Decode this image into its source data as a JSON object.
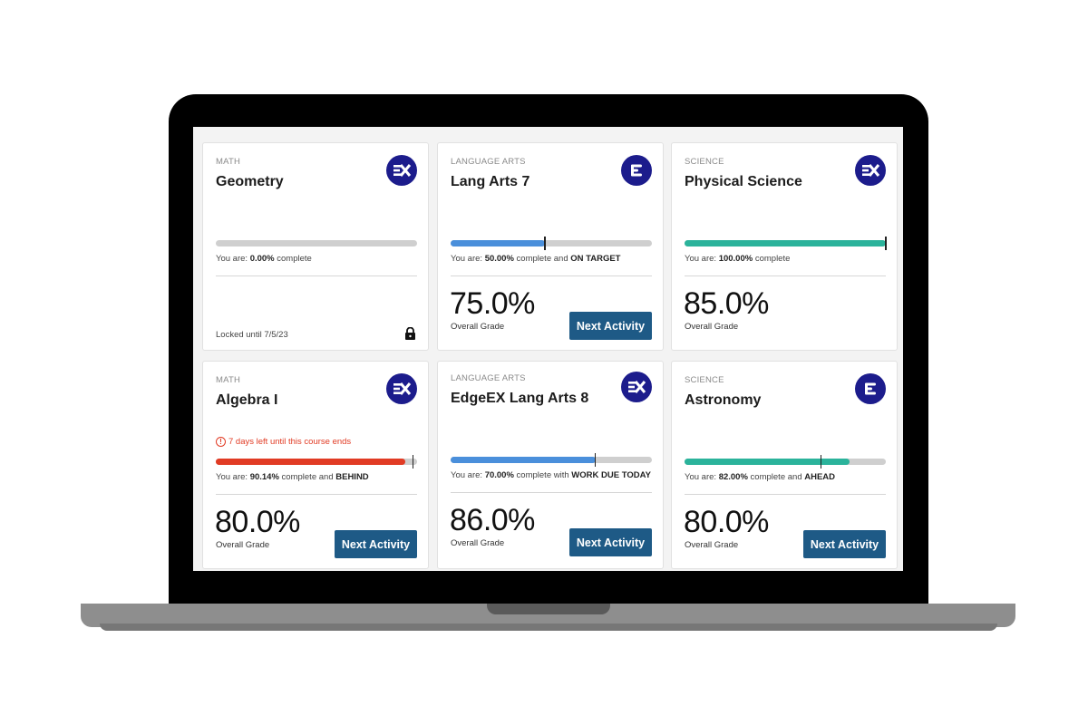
{
  "next_activity_label": "Next Activity",
  "overall_grade_label": "Overall Grade",
  "courses": [
    {
      "subject": "MATH",
      "title": "Geometry",
      "logo": "ex-icon",
      "status_prefix": "You are: ",
      "percent": "0.00%",
      "status_mid": " complete",
      "status_tag": "",
      "progress": 0.0,
      "progress_color": "#cfcfcf",
      "target": null,
      "locked_text": "Locked until 7/5/23"
    },
    {
      "subject": "LANGUAGE ARTS",
      "title": "Lang Arts 7",
      "logo": "e-icon",
      "status_prefix": "You are: ",
      "percent": "50.00%",
      "status_mid": " complete and ",
      "status_tag": "ON TARGET",
      "progress": 0.47,
      "progress_color": "#4a8fdb",
      "target": 0.47,
      "grade": "75.0%"
    },
    {
      "subject": "SCIENCE",
      "title": "Physical Science",
      "logo": "ex-icon",
      "status_prefix": "You are: ",
      "percent": "100.00%",
      "status_mid": " complete",
      "status_tag": "",
      "progress": 1.0,
      "progress_color": "#2bb39b",
      "target": 1.0,
      "grade": "85.0%"
    },
    {
      "subject": "MATH",
      "title": "Algebra I",
      "logo": "ex-icon",
      "warning": "7 days left until this course ends",
      "status_prefix": "You are: ",
      "percent": "90.14%",
      "status_mid": " complete and ",
      "status_tag": "BEHIND",
      "progress": 0.94,
      "progress_color": "#e13b24",
      "target": 0.98,
      "grade": "80.0%"
    },
    {
      "subject": "LANGUAGE ARTS",
      "title": "EdgeEX Lang Arts 8",
      "logo": "ex-icon",
      "status_prefix": "You are: ",
      "percent": "70.00%",
      "status_mid": " complete with ",
      "status_tag": "WORK DUE TODAY",
      "progress": 0.72,
      "progress_color": "#4a8fdb",
      "target": 0.72,
      "grade": "86.0%"
    },
    {
      "subject": "SCIENCE",
      "title": "Astronomy",
      "logo": "e-icon",
      "status_prefix": "You are: ",
      "percent": "82.00%",
      "status_mid": " complete and ",
      "status_tag": "AHEAD",
      "progress": 0.82,
      "progress_color": "#2bb39b",
      "target": 0.68,
      "grade": "80.0%"
    }
  ]
}
